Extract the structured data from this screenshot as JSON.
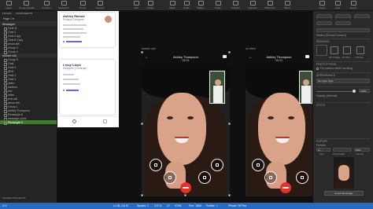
{
  "toolbar": {
    "items": [
      {
        "label": "Insert"
      },
      {
        "label": "Create Symbol"
      },
      {
        "label": "Forward"
      },
      {
        "label": "Backward"
      },
      {
        "label": "Group"
      },
      {
        "label": "Ungroup"
      },
      {
        "label": "Edit"
      },
      {
        "label": "Rotate"
      },
      {
        "label": "Mask"
      },
      {
        "label": "Scale"
      },
      {
        "label": "Flatten"
      },
      {
        "label": "Union"
      },
      {
        "label": "Subtract"
      },
      {
        "label": "Intersect"
      },
      {
        "label": "Difference"
      },
      {
        "label": "Mirror"
      },
      {
        "label": "Cloud"
      },
      {
        "label": "View"
      },
      {
        "label": "Export"
      }
    ]
  },
  "layers": {
    "tabs": [
      "LAYERS",
      "COMPONENTS"
    ],
    "page": "Page 1",
    "rows": [
      {
        "label": "Messages",
        "type": "section"
      },
      {
        "label": "Oval 11"
      },
      {
        "label": "Oval 3"
      },
      {
        "label": "Oval Copy"
      },
      {
        "label": "Oval 8 Copy"
      },
      {
        "label": "arrow-left"
      },
      {
        "label": "Group 3"
      },
      {
        "label": "Group 4"
      },
      {
        "label": "answer call",
        "type": "section"
      },
      {
        "label": "Group 5"
      },
      {
        "label": "Oval"
      },
      {
        "label": "Oval 4"
      },
      {
        "label": "ADD"
      },
      {
        "label": "Oval 2"
      },
      {
        "label": "Oval 3"
      },
      {
        "label": "video"
      },
      {
        "label": "stickers"
      },
      {
        "label": "mic"
      },
      {
        "label": "video"
      },
      {
        "label": "end call"
      },
      {
        "label": "arrow-left"
      },
      {
        "label": "Group 1"
      },
      {
        "label": "Ashley Thompson"
      },
      {
        "label": "Rectangle 8"
      },
      {
        "label": "message-circle"
      },
      {
        "label": "Rectangle 4",
        "selected": true
      }
    ],
    "footer": "SHARED PROJECTS"
  },
  "artboard_mobile": {
    "cards": [
      {
        "name": "Ashley Ramos",
        "role": "Product Designer"
      },
      {
        "name": "Leroy Lloyd",
        "role": "Designer (Contract)"
      }
    ]
  },
  "video_calls": [
    {
      "artboard_label": "answer call",
      "caller": "Ashley Thompson",
      "time": "05:23"
    },
    {
      "artboard_label": "on video",
      "caller": "Ashley Thompson",
      "time": "05:23"
    }
  ],
  "inspector": {
    "radius_label": "Radius (Round Corners)",
    "resizing_label": "RESIZING",
    "pin_labels": [
      "Pin to Edge",
      "Fix Size",
      "Preview"
    ],
    "prototyping_label": "PROTOTYPING",
    "fix_position_label": "Fix position when scrolling",
    "appearance_label": "APPEARANCE",
    "layer_style_value": "No Layer Style",
    "opacity_label": "Opacity (Normal)",
    "opacity_value": "100%",
    "style_label": "STYLE",
    "export_label": "EXPORT",
    "export_preset_label": "Presets",
    "export_values": [
      "1x",
      "",
      "PNG"
    ],
    "export_sub_labels": [
      "Size",
      "Prefix/Suffix",
      "Format"
    ],
    "export_button": "Export Rectangle"
  },
  "statusbar": {
    "left": "⊙ 0",
    "items": [
      "Ln 38, Col 67",
      "Spaces: 2",
      "UTF-8",
      "LF",
      "HTML",
      "Port : 5500",
      "Prettier: ✓"
    ],
    "device": "iPhone 7/8 Plus"
  },
  "colors": {
    "accent_green": "#3e7d2b",
    "status_blue": "#2a6bbd",
    "end_call_red": "#e5332a"
  }
}
